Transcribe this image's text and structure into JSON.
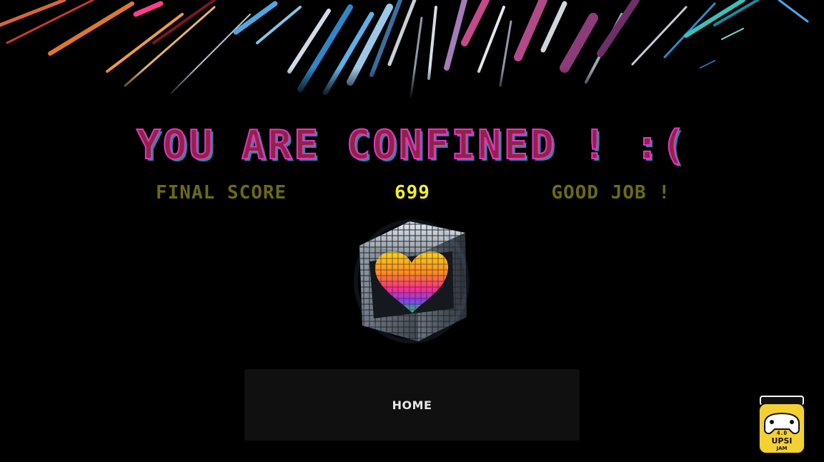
{
  "game_over": {
    "title": "YOU ARE CONFINED ! :(",
    "score_label": "FINAL SCORE",
    "score_value": "699",
    "message": "GOOD JOB !"
  },
  "actions": {
    "home_label": "HOME"
  },
  "jam_logo": {
    "line1": "4.0",
    "line2": "UPSI",
    "line3": "JAM"
  },
  "colors": {
    "background": "#000000",
    "title_fill": "#8e2449",
    "title_outline": "#e535c0",
    "title_shadow": "#1b8fa3",
    "label_olive": "#6c6a14",
    "score_yellow": "#f2ee2e",
    "button_bg": "#101010",
    "logo_yellow": "#f5d033"
  }
}
